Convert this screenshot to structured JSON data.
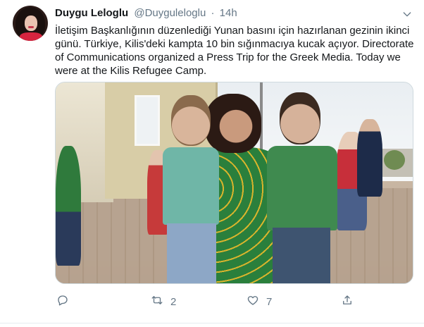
{
  "tweet": {
    "author_name": "Duygu Leloglu",
    "author_handle": "@Duyguleloglu",
    "separator": "·",
    "time": "14h",
    "text_lines": [
      "İletişim Başkanlığının düzenlediği Yunan basını için hazırlanan gezinin ikinci",
      "günü. Türkiye, Kilis'deki kampta 10 bin sığınmacıya kucak açıyor. Directorate",
      "of Communications organized a Press Trip for the Greek Media. Today we",
      "were at the Kilis Refugee Camp."
    ],
    "actions": {
      "reply_icon": "reply-icon",
      "retweet_icon": "retweet-icon",
      "retweet_count": "2",
      "like_icon": "heart-icon",
      "like_count": "7",
      "share_icon": "share-icon"
    }
  },
  "colors": {
    "text": "#14171a",
    "secondary": "#657786",
    "border": "#cfd9de",
    "background": "#ffffff"
  }
}
